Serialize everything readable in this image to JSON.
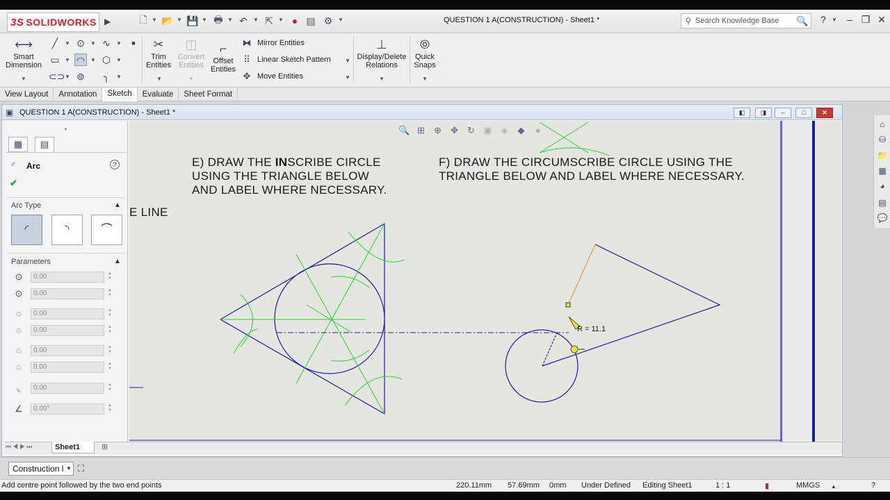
{
  "app": {
    "logo_text": "SOLIDWORKS",
    "logo_mark": "3S",
    "document_title": "QUESTION 1 A(CONSTRUCTION) - Sheet1 *",
    "search_placeholder": "Search Knowledge Base",
    "help_label": "?"
  },
  "ribbon": {
    "smart_dimension": "Smart\nDimension",
    "trim_entities": "Trim\nEntities",
    "convert_entities": "Convert\nEntities",
    "offset_entities": "Offset\nEntities",
    "mirror_entities": "Mirror Entities",
    "linear_sketch_pattern": "Linear Sketch Pattern",
    "move_entities": "Move Entities",
    "display_delete_relations": "Display/Delete\nRelations",
    "quick_snaps": "Quick\nSnaps"
  },
  "tabs": [
    {
      "label": "View Layout",
      "active": false
    },
    {
      "label": "Annotation",
      "active": false
    },
    {
      "label": "Sketch",
      "active": true
    },
    {
      "label": "Evaluate",
      "active": false
    },
    {
      "label": "Sheet Format",
      "active": false
    }
  ],
  "document_window": {
    "title": "QUESTION 1 A(CONSTRUCTION) - Sheet1 *"
  },
  "property_manager": {
    "title": "Arc",
    "arc_type_label": "Arc Type",
    "parameters_label": "Parameters",
    "params": [
      "0.00",
      "0.00",
      "0.00",
      "0.00",
      "0.00",
      "0.00",
      "0.00",
      "0.00°"
    ]
  },
  "drawing": {
    "note_e_prefix": "E) DRAW THE ",
    "note_e_bold": "IN",
    "note_e_rest": "SCRIBE CIRCLE",
    "note_e_line2": "USING THE TRIANGLE BELOW",
    "note_e_line3": "AND LABEL WHERE NECESSARY.",
    "note_f_line1": "F) DRAW THE CIRCUMSCRIBE CIRCLE USING THE",
    "note_f_line2": "TRIANGLE BELOW AND LABEL WHERE NECESSARY.",
    "partial_note": "E LINE",
    "radius_readout": "R = 11.1"
  },
  "sheet_tab": "Sheet1",
  "layer_value": "Construction l",
  "status": {
    "prompt": "Add centre point followed by the two end points",
    "x": "220.11mm",
    "y": "57.69mm",
    "z": "0mm",
    "state": "Under Defined",
    "mode": "Editing Sheet1",
    "scale": "1 : 1",
    "units": "MMGS"
  },
  "colors": {
    "sketch_blue": "#1c1ca8",
    "construction_green": "#2ed12e",
    "preview_orange": "#f08a24"
  }
}
